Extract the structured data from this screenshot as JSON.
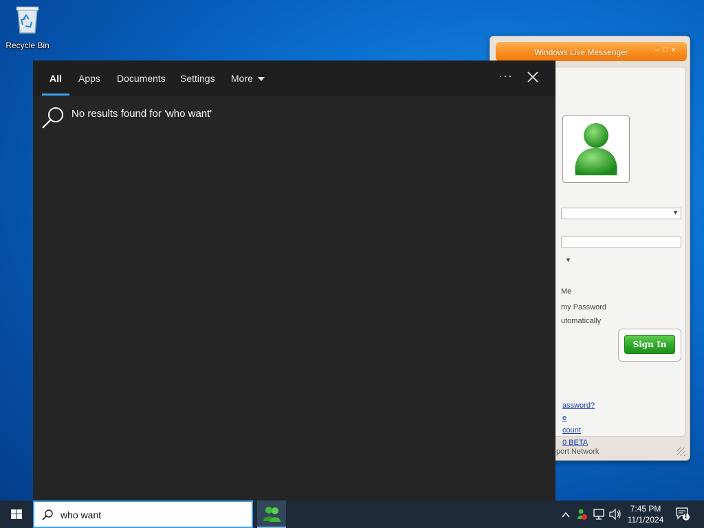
{
  "desktop": {
    "recycle_bin_label": "Recycle Bin"
  },
  "messenger": {
    "title": "Windows Live Messenger",
    "options": [
      "Me",
      "my Password",
      "utomatically"
    ],
    "sign_in_label": "Sign In",
    "links": [
      "assword?",
      "e",
      "count",
      "0 BETA"
    ],
    "footer": "port Network"
  },
  "search": {
    "tabs": [
      {
        "label": "All",
        "active": true
      },
      {
        "label": "Apps",
        "active": false
      },
      {
        "label": "Documents",
        "active": false
      },
      {
        "label": "Settings",
        "active": false
      },
      {
        "label": "More",
        "active": false
      }
    ],
    "more_options_glyph": "···",
    "no_results_text": "No results found for 'who want'",
    "query": "who want",
    "accent_color": "#3ea0ec",
    "panel_color": "#252525"
  },
  "taskbar": {
    "time": "7:45 PM",
    "date": "11/1/2024",
    "notification_count": "1"
  }
}
